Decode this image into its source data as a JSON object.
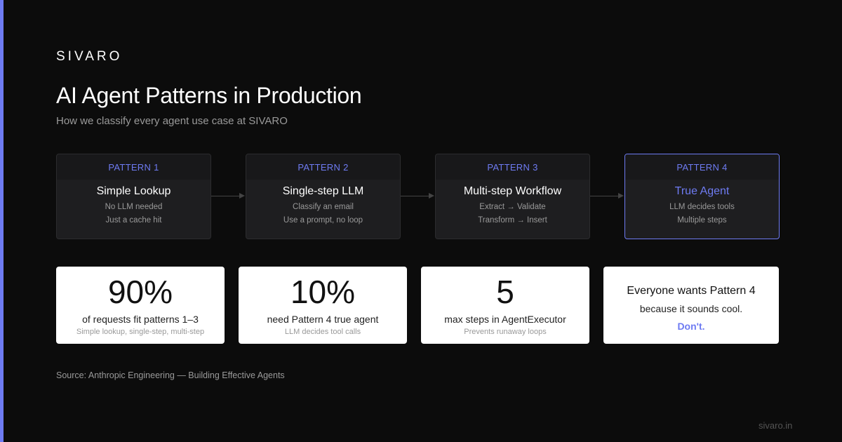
{
  "brand": "SIVARO",
  "title": "AI Agent Patterns in Production",
  "subtitle": "How we classify every agent use case at SIVARO",
  "patterns": [
    {
      "tag": "PATTERN 1",
      "name": "Simple Lookup",
      "line1": "No LLM needed",
      "line2": "Just a cache hit"
    },
    {
      "tag": "PATTERN 2",
      "name": "Single-step LLM",
      "line1": "Classify an email",
      "line2": "Use a prompt, no loop"
    },
    {
      "tag": "PATTERN 3",
      "name": "Multi-step Workflow",
      "line1": "Extract → Validate",
      "line2": "Transform → Insert"
    },
    {
      "tag": "PATTERN 4",
      "name": "True Agent",
      "line1": "LLM decides tools",
      "line2": "Multiple steps"
    }
  ],
  "stats": [
    {
      "value": "90%",
      "label": "of requests fit patterns 1–3",
      "sub": "Simple lookup, single-step, multi-step"
    },
    {
      "value": "10%",
      "label": "need Pattern 4 true agent",
      "sub": "LLM decides tool calls"
    },
    {
      "value": "5",
      "label": "max steps in AgentExecutor",
      "sub": "Prevents runaway loops"
    }
  ],
  "callout": {
    "title": "Everyone wants Pattern 4",
    "line": "because it sounds cool.",
    "punch": "Don't."
  },
  "source": "Source: Anthropic Engineering — Building Effective Agents",
  "footer_url": "sivaro.in",
  "colors": {
    "accent": "#6e7bf2",
    "background": "#0c0c0c",
    "card": "#1e1e20"
  }
}
